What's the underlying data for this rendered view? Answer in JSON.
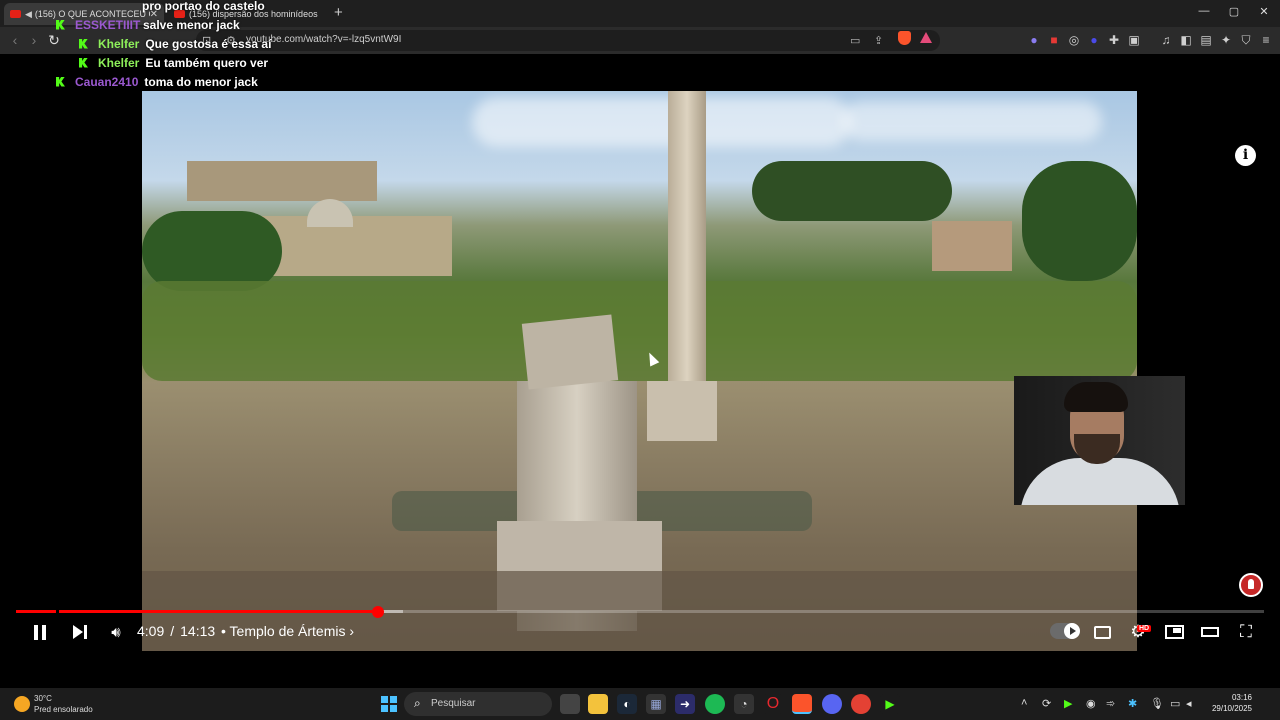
{
  "browser": {
    "tabs": [
      {
        "title": "(156) O QUE ACONTECEU CO"
      },
      {
        "title": "(156) dispersão dos hominídeos - Yo"
      }
    ],
    "url": "youtube.com/watch?v=-lzq5vntW9I"
  },
  "chat": {
    "messages": [
      {
        "user": "",
        "text": "pro portao do castelo",
        "color": "#ffffff"
      },
      {
        "user": "ESSKETIIIT",
        "text": "salve menor jack",
        "color": "#9b59d0"
      },
      {
        "user": "Khelfer",
        "text": "Que gostosa é essa aí",
        "color": "#8ef05a"
      },
      {
        "user": "Khelfer",
        "text": "Eu também quero ver",
        "color": "#8ef05a"
      },
      {
        "user": "Cauan2410",
        "text": "toma do menor jack",
        "color": "#9b59d0"
      }
    ]
  },
  "player": {
    "current_time": "4:09",
    "duration": "14:13",
    "chapter": "Templo de Ártemis",
    "progress": 0.29,
    "buffered": 0.31,
    "hd_badge": "HD",
    "accent": "#ff0000"
  },
  "taskbar": {
    "temperature": "30°C",
    "weather": "Pred ensolarado",
    "search_placeholder": "Pesquisar",
    "time": "03:16",
    "date": "29/10/2025"
  }
}
